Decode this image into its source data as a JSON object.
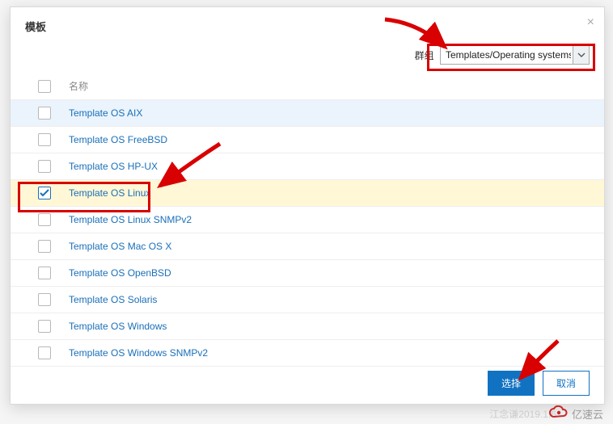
{
  "dialog": {
    "title": "模板",
    "close_label": "×",
    "group_label": "群组",
    "group_selected": "Templates/Operating systems"
  },
  "columns": {
    "name": "名称"
  },
  "rows": [
    {
      "label": "Template OS AIX",
      "checked": false,
      "state": "hover"
    },
    {
      "label": "Template OS FreeBSD",
      "checked": false,
      "state": ""
    },
    {
      "label": "Template OS HP-UX",
      "checked": false,
      "state": ""
    },
    {
      "label": "Template OS Linux",
      "checked": true,
      "state": "selected"
    },
    {
      "label": "Template OS Linux SNMPv2",
      "checked": false,
      "state": ""
    },
    {
      "label": "Template OS Mac OS X",
      "checked": false,
      "state": ""
    },
    {
      "label": "Template OS OpenBSD",
      "checked": false,
      "state": ""
    },
    {
      "label": "Template OS Solaris",
      "checked": false,
      "state": ""
    },
    {
      "label": "Template OS Windows",
      "checked": false,
      "state": ""
    },
    {
      "label": "Template OS Windows SNMPv2",
      "checked": false,
      "state": ""
    }
  ],
  "footer": {
    "select": "选择",
    "cancel": "取消"
  },
  "watermark": {
    "behind": "江念谦2019.1.6",
    "brand": "亿速云"
  }
}
